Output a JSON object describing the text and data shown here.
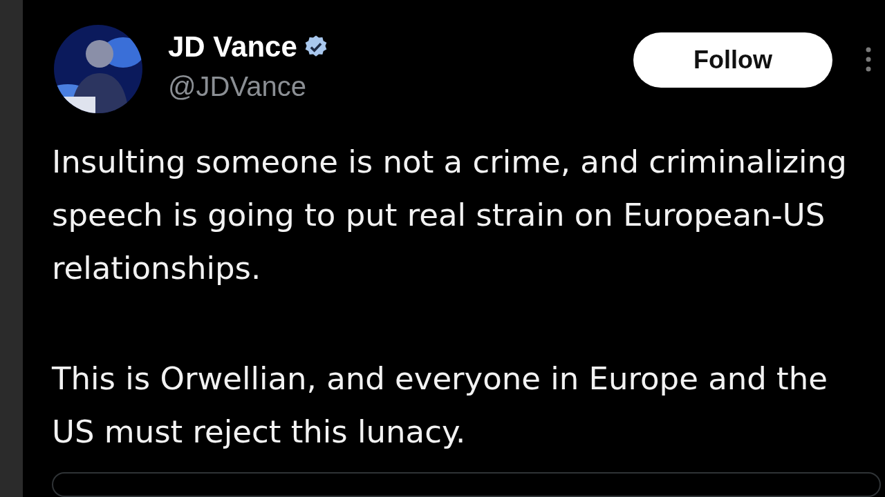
{
  "post": {
    "author": {
      "name": "JD Vance",
      "verified": true,
      "handle": "@JDVance"
    },
    "follow_button": {
      "label": "Follow"
    },
    "paragraphs": [
      "Insulting someone is not a crime, and criminalizing speech is going to put real strain on European-US relationships.",
      "This is Orwellian, and everyone in Europe and the US must reject this lunacy."
    ]
  }
}
